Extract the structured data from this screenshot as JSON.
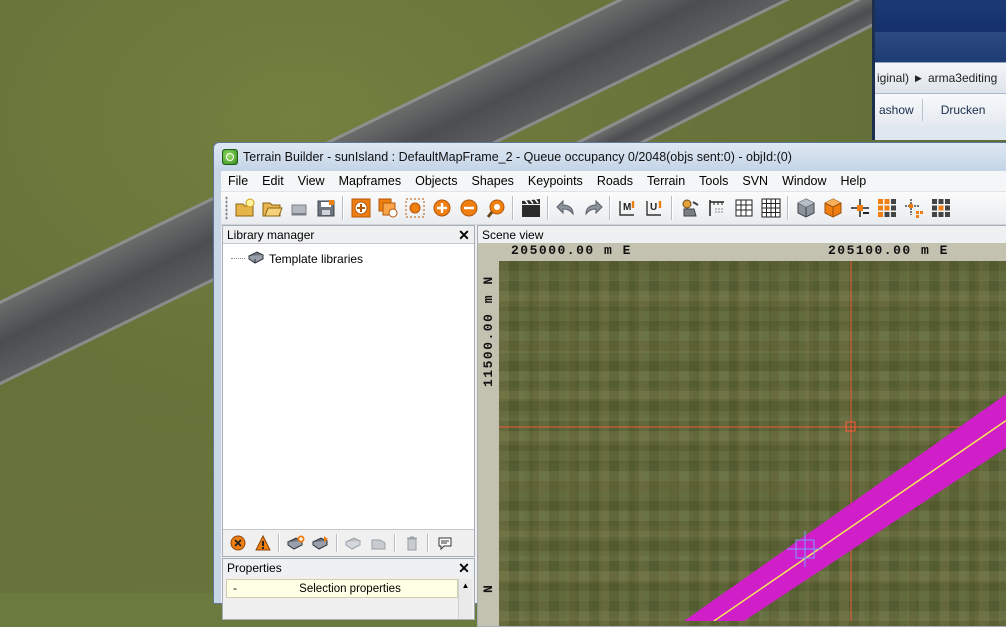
{
  "browser": {
    "breadcrumb_partial": "iginal)",
    "breadcrumb_next": "arma3editing",
    "toolbar_items": [
      "ashow",
      "Drucken"
    ]
  },
  "window": {
    "title": "Terrain Builder - sunIsland : DefaultMapFrame_2 - Queue occupancy 0/2048(objs sent:0) - objId:(0)"
  },
  "menu": [
    "File",
    "Edit",
    "View",
    "Mapframes",
    "Objects",
    "Shapes",
    "Keypoints",
    "Roads",
    "Terrain",
    "Tools",
    "SVN",
    "Window",
    "Help"
  ],
  "library_manager": {
    "title": "Library manager",
    "tree": [
      "Template libraries"
    ]
  },
  "properties": {
    "title": "Properties",
    "row_label": "Selection properties",
    "row_prefix": "-"
  },
  "scene_view": {
    "title": "Scene view",
    "easting_1": "205000.00 m E",
    "easting_2": "205100.00 m E",
    "northing": "11500.00 m N",
    "northing_2": "N",
    "cursor_marker_color": "#ff5a3c",
    "road_color": "#d01ec8",
    "centerline_color": "#f5e65a"
  },
  "colors": {
    "accent": "#f07f12",
    "title_bg": "#c9d6e5"
  }
}
